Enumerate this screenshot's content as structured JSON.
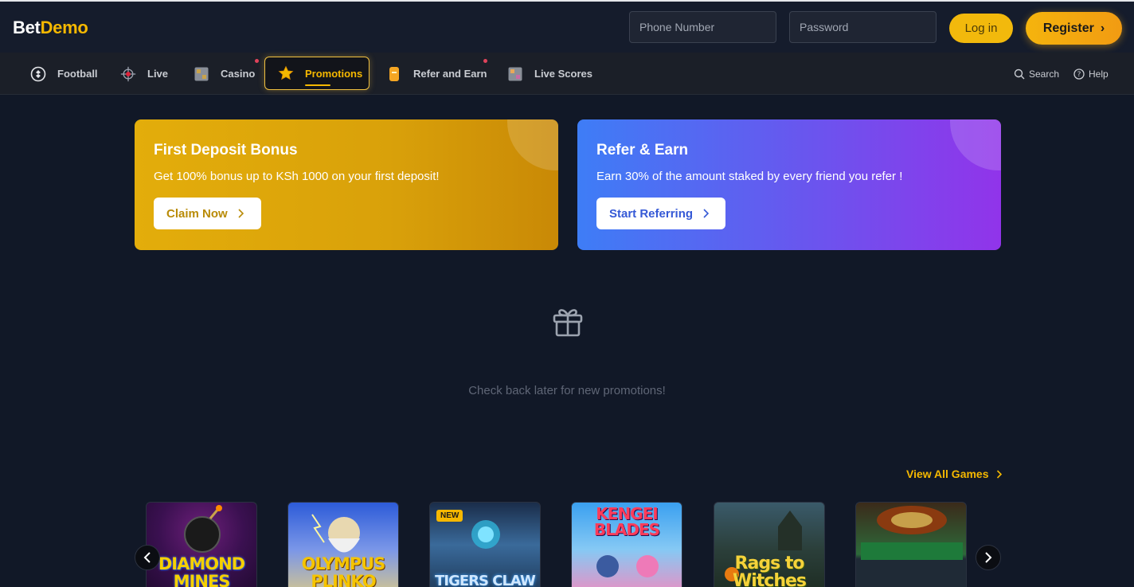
{
  "header": {
    "logo_part1": "Bet",
    "logo_part2": "Demo",
    "phone_placeholder": "Phone Number",
    "password_placeholder": "Password",
    "login_label": "Log in",
    "register_label": "Register"
  },
  "nav": {
    "items": [
      {
        "label": "Football",
        "icon": "football-icon"
      },
      {
        "label": "Live",
        "icon": "live-target-icon"
      },
      {
        "label": "Casino",
        "icon": "casino-icon"
      },
      {
        "label": "Promotions",
        "icon": "star-icon",
        "active": true
      },
      {
        "label": "Refer and Earn",
        "icon": "refer-icon"
      },
      {
        "label": "Live Scores",
        "icon": "live-scores-icon"
      }
    ],
    "search_label": "Search",
    "help_label": "Help"
  },
  "promos": {
    "deposit": {
      "title": "First Deposit Bonus",
      "description": "Get 100% bonus up to KSh 1000 on your first deposit!",
      "cta": "Claim Now"
    },
    "refer": {
      "title": "Refer & Earn",
      "description": "Earn 30% of the amount staked by every friend you refer !",
      "cta": "Start Referring"
    }
  },
  "empty_state": {
    "message": "Check back later for new promotions!"
  },
  "games": {
    "view_all_label": "View All Games",
    "items": [
      {
        "title": "DIAMOND MINES"
      },
      {
        "title": "OLYMPUS PLINKO"
      },
      {
        "title": "TIGERS CLAW",
        "badge": "NEW"
      },
      {
        "title": "KENGEI BLADES"
      },
      {
        "title": "Rags to Witches"
      },
      {
        "title": ""
      }
    ]
  },
  "colors": {
    "accent": "#f5b800",
    "background": "#111827",
    "header": "#151c2c",
    "navbar": "#1b1f28",
    "deposit_card": "#e3ad0b",
    "refer_card_start": "#3e7df6",
    "refer_card_end": "#9134ea"
  }
}
